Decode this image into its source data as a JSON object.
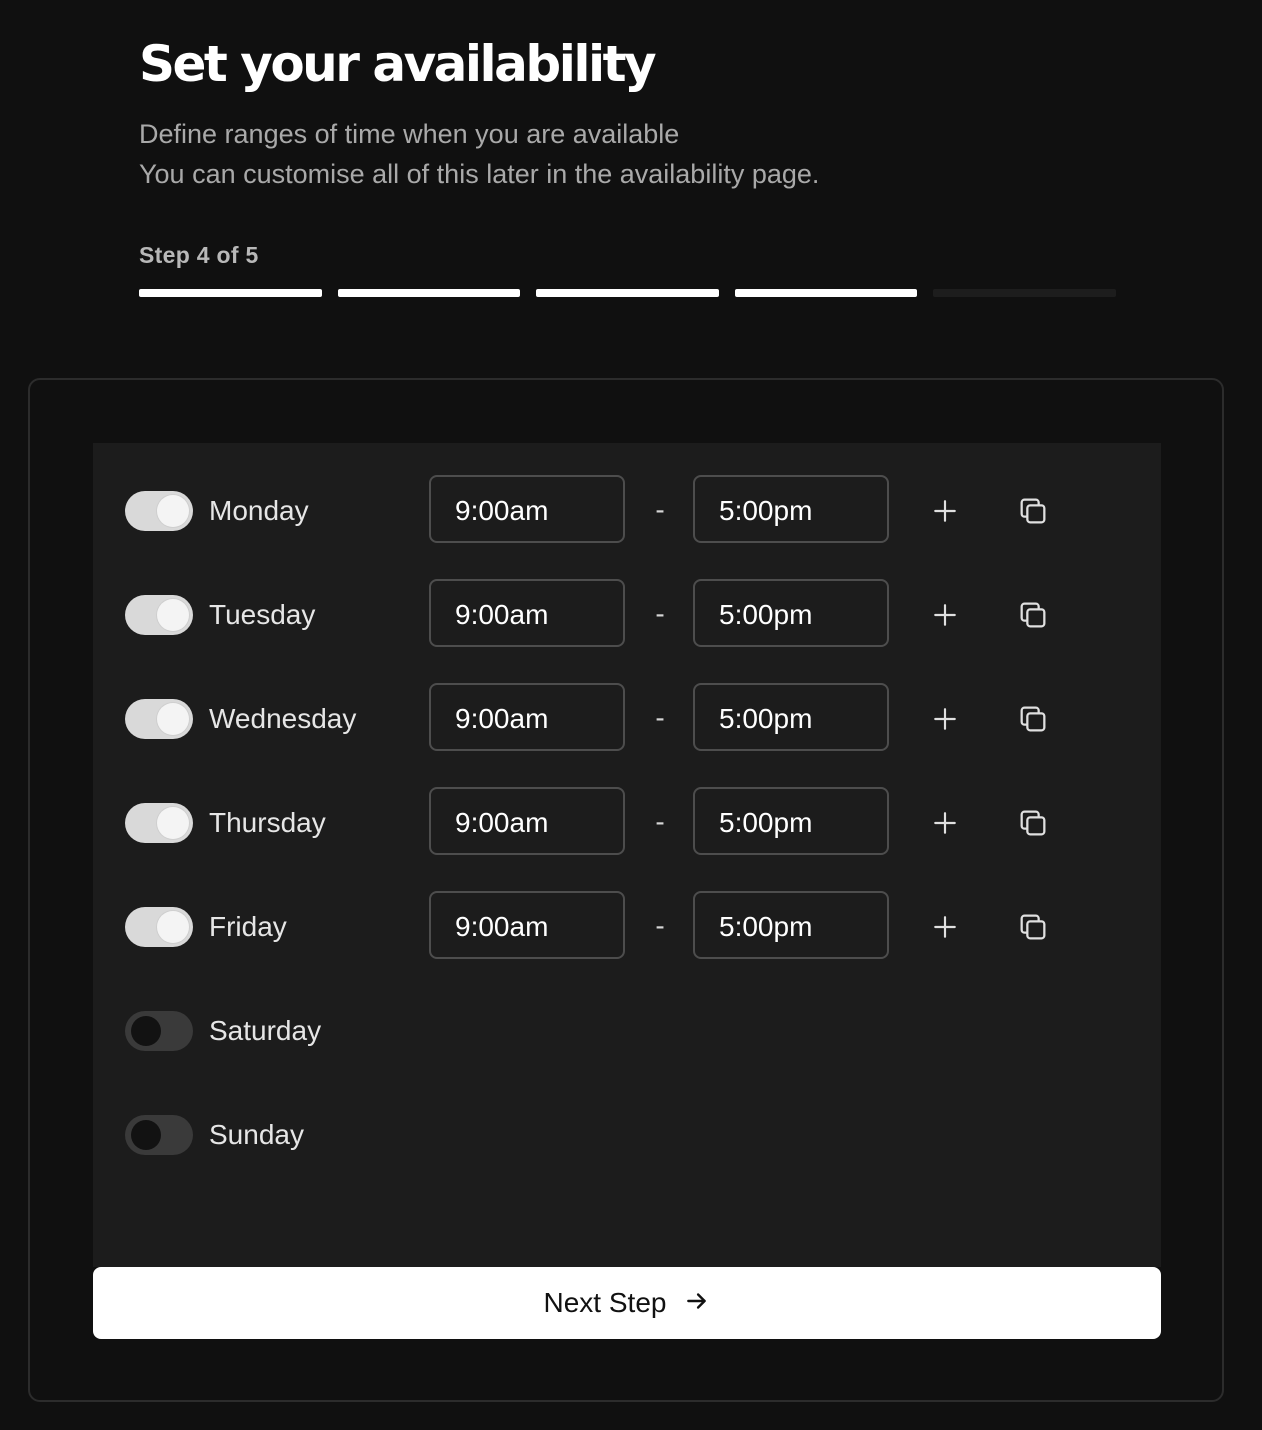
{
  "header": {
    "title": "Set your availability",
    "description_line1": "Define ranges of time when you are available",
    "description_line2": "You can customise all of this later in the availability page."
  },
  "progress": {
    "label": "Step 4 of 5",
    "current_step": 4,
    "total_steps": 5
  },
  "schedule": {
    "days": [
      {
        "name": "Monday",
        "enabled": true,
        "start": "9:00am",
        "end": "5:00pm"
      },
      {
        "name": "Tuesday",
        "enabled": true,
        "start": "9:00am",
        "end": "5:00pm"
      },
      {
        "name": "Wednesday",
        "enabled": true,
        "start": "9:00am",
        "end": "5:00pm"
      },
      {
        "name": "Thursday",
        "enabled": true,
        "start": "9:00am",
        "end": "5:00pm"
      },
      {
        "name": "Friday",
        "enabled": true,
        "start": "9:00am",
        "end": "5:00pm"
      },
      {
        "name": "Saturday",
        "enabled": false
      },
      {
        "name": "Sunday",
        "enabled": false
      }
    ],
    "separator": "-"
  },
  "actions": {
    "next_label": "Next Step"
  },
  "icons": {
    "add": "plus-icon",
    "copy": "copy-icon",
    "next": "arrow-right-icon"
  },
  "colors": {
    "background": "#101010",
    "panel": "#1c1c1c",
    "toggle_on": "#d9d9d9",
    "toggle_off": "#3a3a3a",
    "button": "#ffffff"
  }
}
